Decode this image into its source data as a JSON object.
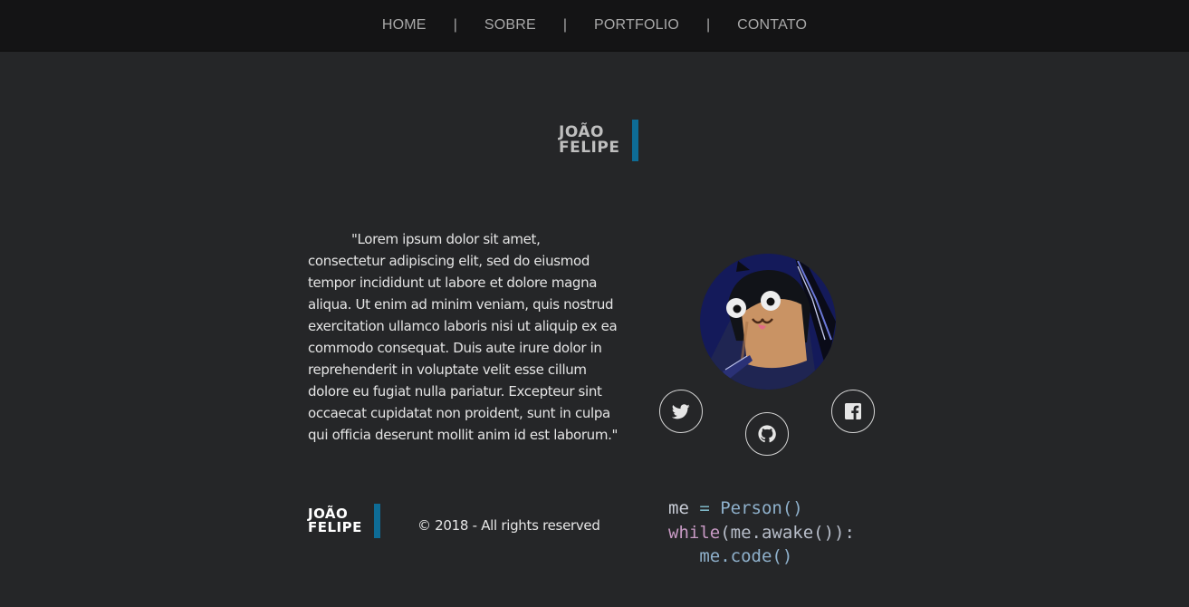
{
  "nav": {
    "items": [
      "HOME",
      "SOBRE",
      "PORTFOLIO",
      "CONTATO"
    ],
    "separator": "|"
  },
  "logo": {
    "line1": "JOÃO",
    "line2": "FELIPE",
    "accent_color": "#0e6c96"
  },
  "about": {
    "text": "\"Lorem ipsum dolor sit amet, consectetur adipiscing elit, sed do eiusmod tempor incididunt ut labore et dolore magna aliqua. Ut enim ad minim veniam, quis nostrud exercitation ullamco laboris nisi ut aliquip ex ea commodo consequat. Duis aute irure dolor in reprehenderit in voluptate velit esse cillum dolore eu fugiat nulla pariatur. Excepteur sint occaecat cupidatat non proident, sunt in culpa qui officia deserunt mollit anim id est laborum.\""
  },
  "social": {
    "icons": [
      "twitter-icon",
      "github-icon",
      "facebook-icon"
    ]
  },
  "footer": {
    "copyright": "© 2018 - All rights reserved"
  },
  "code": {
    "l1_var": "me",
    "l1_op": " = ",
    "l1_cls": "Person",
    "l1_paren": "()",
    "l2_kw": "while",
    "l2_rest": "(me.awake()):",
    "l3_indent": "   ",
    "l3_call": "me.code()"
  },
  "colors": {
    "background": "#252628",
    "nav_background": "#141415",
    "accent": "#0e6c96"
  }
}
